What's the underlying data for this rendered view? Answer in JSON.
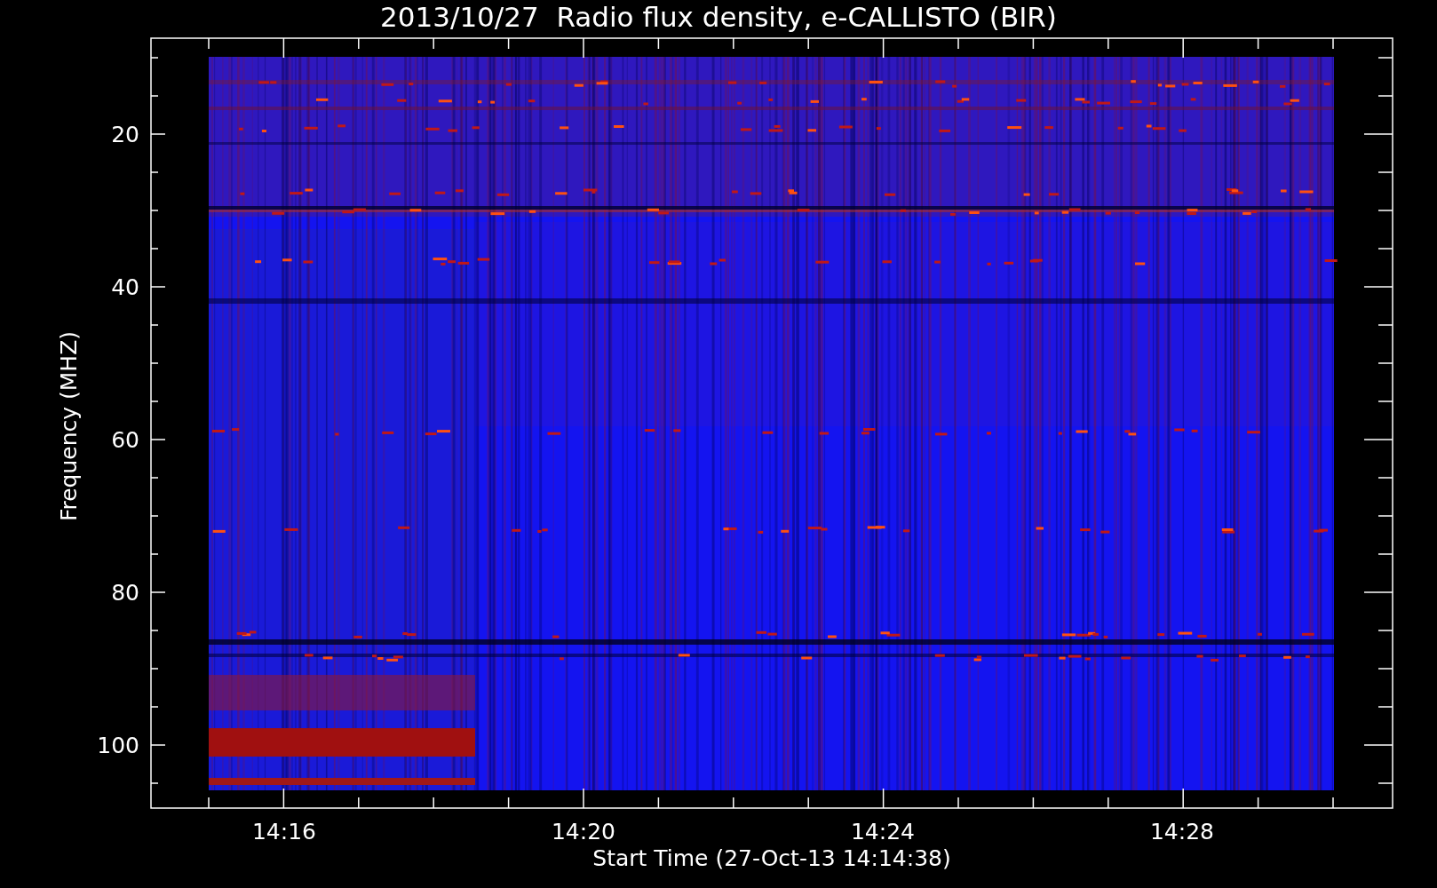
{
  "title": "2013/10/27  Radio flux density, e-CALLISTO (BIR)",
  "y_axis": {
    "label": "Frequency (MHZ)",
    "ticks": [
      "20",
      "40",
      "60",
      "80",
      "100"
    ]
  },
  "x_axis": {
    "label": "Start Time (27-Oct-13 14:14:38)",
    "ticks": [
      "14:16",
      "14:20",
      "14:24",
      "14:28"
    ]
  }
}
